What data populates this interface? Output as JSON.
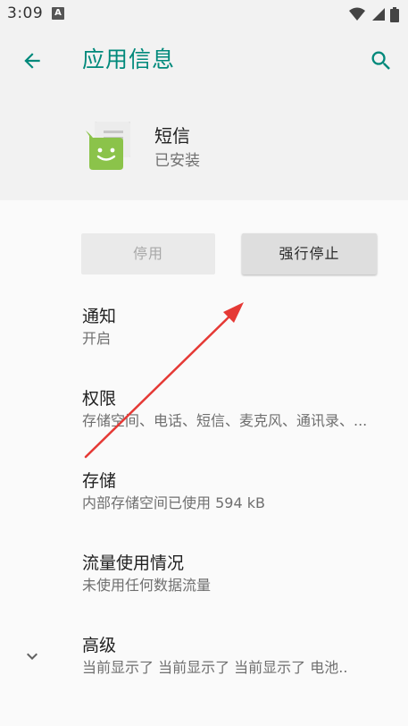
{
  "status_bar": {
    "time": "3:09",
    "notification_badge": "A",
    "icons": [
      "wifi-icon",
      "signal-icon",
      "battery-icon"
    ]
  },
  "header": {
    "title": "应用信息",
    "back_icon": "arrow-left-icon",
    "search_icon": "search-icon"
  },
  "app": {
    "name": "短信",
    "status": "已安装",
    "icon": "messaging-app-icon"
  },
  "buttons": {
    "disable": "停用",
    "force_stop": "强行停止"
  },
  "items": [
    {
      "title": "通知",
      "subtitle": "开启"
    },
    {
      "title": "权限",
      "subtitle": "存储空间、电话、短信、麦克风、通讯录、..."
    },
    {
      "title": "存储",
      "subtitle": "内部存储空间已使用 594 kB"
    },
    {
      "title": "流量使用情况",
      "subtitle": "未使用任何数据流量"
    },
    {
      "title": "高级",
      "subtitle": "当前显示了 当前显示了 当前显示了 电池.."
    }
  ],
  "colors": {
    "accent": "#00897b",
    "app_icon_green": "#8bc34a",
    "annotation_arrow": "#e53935"
  }
}
